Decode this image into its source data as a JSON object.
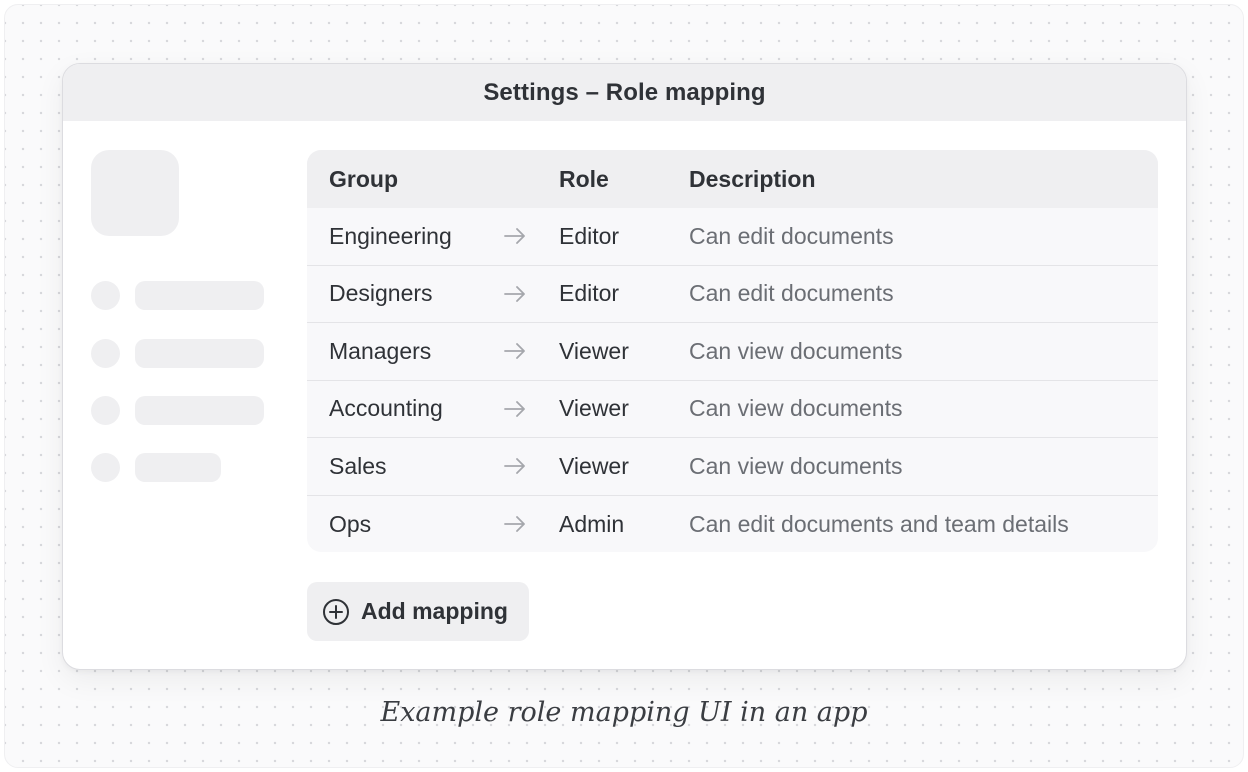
{
  "window": {
    "title": "Settings – Role mapping"
  },
  "table": {
    "headers": {
      "group": "Group",
      "role": "Role",
      "description": "Description"
    },
    "rows": [
      {
        "group": "Engineering",
        "role": "Editor",
        "description": "Can edit documents"
      },
      {
        "group": "Designers",
        "role": "Editor",
        "description": "Can edit documents"
      },
      {
        "group": "Managers",
        "role": "Viewer",
        "description": "Can view documents"
      },
      {
        "group": "Accounting",
        "role": "Viewer",
        "description": "Can view documents"
      },
      {
        "group": "Sales",
        "role": "Viewer",
        "description": "Can view documents"
      },
      {
        "group": "Ops",
        "role": "Admin",
        "description": "Can edit documents and team details"
      }
    ],
    "arrow_icon": "arrow-right-icon"
  },
  "add_button": {
    "label": "Add mapping",
    "icon": "plus-circle-icon"
  },
  "caption": "Example role mapping UI in an app",
  "colors": {
    "titlebar": "#efeff1",
    "table_body": "#f8f8fa",
    "text_primary": "#2f3237",
    "text_secondary": "#6b6e74",
    "arrow": "#a5a7ac"
  }
}
